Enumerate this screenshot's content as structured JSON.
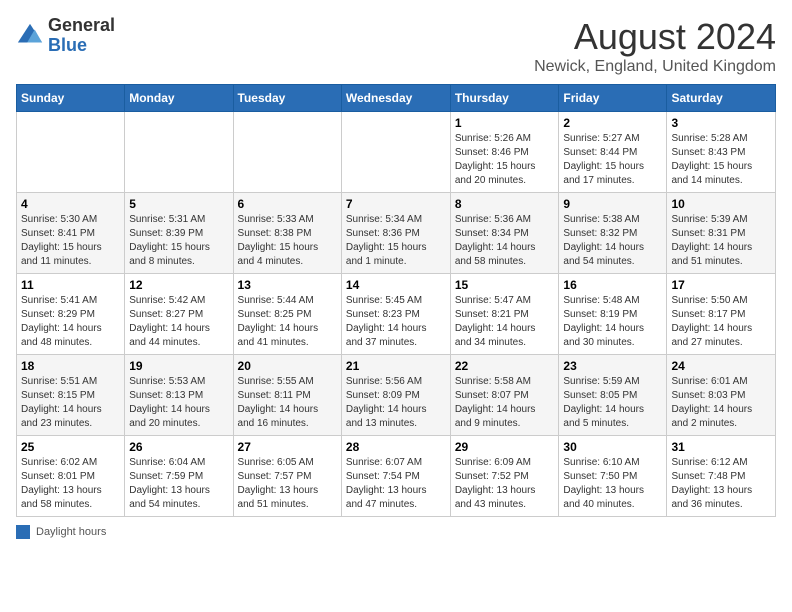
{
  "logo": {
    "general": "General",
    "blue": "Blue"
  },
  "title": "August 2024",
  "subtitle": "Newick, England, United Kingdom",
  "days_of_week": [
    "Sunday",
    "Monday",
    "Tuesday",
    "Wednesday",
    "Thursday",
    "Friday",
    "Saturday"
  ],
  "legend_label": "Daylight hours",
  "weeks": [
    [
      {
        "day": "",
        "info": ""
      },
      {
        "day": "",
        "info": ""
      },
      {
        "day": "",
        "info": ""
      },
      {
        "day": "",
        "info": ""
      },
      {
        "day": "1",
        "info": "Sunrise: 5:26 AM\nSunset: 8:46 PM\nDaylight: 15 hours and 20 minutes."
      },
      {
        "day": "2",
        "info": "Sunrise: 5:27 AM\nSunset: 8:44 PM\nDaylight: 15 hours and 17 minutes."
      },
      {
        "day": "3",
        "info": "Sunrise: 5:28 AM\nSunset: 8:43 PM\nDaylight: 15 hours and 14 minutes."
      }
    ],
    [
      {
        "day": "4",
        "info": "Sunrise: 5:30 AM\nSunset: 8:41 PM\nDaylight: 15 hours and 11 minutes."
      },
      {
        "day": "5",
        "info": "Sunrise: 5:31 AM\nSunset: 8:39 PM\nDaylight: 15 hours and 8 minutes."
      },
      {
        "day": "6",
        "info": "Sunrise: 5:33 AM\nSunset: 8:38 PM\nDaylight: 15 hours and 4 minutes."
      },
      {
        "day": "7",
        "info": "Sunrise: 5:34 AM\nSunset: 8:36 PM\nDaylight: 15 hours and 1 minute."
      },
      {
        "day": "8",
        "info": "Sunrise: 5:36 AM\nSunset: 8:34 PM\nDaylight: 14 hours and 58 minutes."
      },
      {
        "day": "9",
        "info": "Sunrise: 5:38 AM\nSunset: 8:32 PM\nDaylight: 14 hours and 54 minutes."
      },
      {
        "day": "10",
        "info": "Sunrise: 5:39 AM\nSunset: 8:31 PM\nDaylight: 14 hours and 51 minutes."
      }
    ],
    [
      {
        "day": "11",
        "info": "Sunrise: 5:41 AM\nSunset: 8:29 PM\nDaylight: 14 hours and 48 minutes."
      },
      {
        "day": "12",
        "info": "Sunrise: 5:42 AM\nSunset: 8:27 PM\nDaylight: 14 hours and 44 minutes."
      },
      {
        "day": "13",
        "info": "Sunrise: 5:44 AM\nSunset: 8:25 PM\nDaylight: 14 hours and 41 minutes."
      },
      {
        "day": "14",
        "info": "Sunrise: 5:45 AM\nSunset: 8:23 PM\nDaylight: 14 hours and 37 minutes."
      },
      {
        "day": "15",
        "info": "Sunrise: 5:47 AM\nSunset: 8:21 PM\nDaylight: 14 hours and 34 minutes."
      },
      {
        "day": "16",
        "info": "Sunrise: 5:48 AM\nSunset: 8:19 PM\nDaylight: 14 hours and 30 minutes."
      },
      {
        "day": "17",
        "info": "Sunrise: 5:50 AM\nSunset: 8:17 PM\nDaylight: 14 hours and 27 minutes."
      }
    ],
    [
      {
        "day": "18",
        "info": "Sunrise: 5:51 AM\nSunset: 8:15 PM\nDaylight: 14 hours and 23 minutes."
      },
      {
        "day": "19",
        "info": "Sunrise: 5:53 AM\nSunset: 8:13 PM\nDaylight: 14 hours and 20 minutes."
      },
      {
        "day": "20",
        "info": "Sunrise: 5:55 AM\nSunset: 8:11 PM\nDaylight: 14 hours and 16 minutes."
      },
      {
        "day": "21",
        "info": "Sunrise: 5:56 AM\nSunset: 8:09 PM\nDaylight: 14 hours and 13 minutes."
      },
      {
        "day": "22",
        "info": "Sunrise: 5:58 AM\nSunset: 8:07 PM\nDaylight: 14 hours and 9 minutes."
      },
      {
        "day": "23",
        "info": "Sunrise: 5:59 AM\nSunset: 8:05 PM\nDaylight: 14 hours and 5 minutes."
      },
      {
        "day": "24",
        "info": "Sunrise: 6:01 AM\nSunset: 8:03 PM\nDaylight: 14 hours and 2 minutes."
      }
    ],
    [
      {
        "day": "25",
        "info": "Sunrise: 6:02 AM\nSunset: 8:01 PM\nDaylight: 13 hours and 58 minutes."
      },
      {
        "day": "26",
        "info": "Sunrise: 6:04 AM\nSunset: 7:59 PM\nDaylight: 13 hours and 54 minutes."
      },
      {
        "day": "27",
        "info": "Sunrise: 6:05 AM\nSunset: 7:57 PM\nDaylight: 13 hours and 51 minutes."
      },
      {
        "day": "28",
        "info": "Sunrise: 6:07 AM\nSunset: 7:54 PM\nDaylight: 13 hours and 47 minutes."
      },
      {
        "day": "29",
        "info": "Sunrise: 6:09 AM\nSunset: 7:52 PM\nDaylight: 13 hours and 43 minutes."
      },
      {
        "day": "30",
        "info": "Sunrise: 6:10 AM\nSunset: 7:50 PM\nDaylight: 13 hours and 40 minutes."
      },
      {
        "day": "31",
        "info": "Sunrise: 6:12 AM\nSunset: 7:48 PM\nDaylight: 13 hours and 36 minutes."
      }
    ]
  ]
}
